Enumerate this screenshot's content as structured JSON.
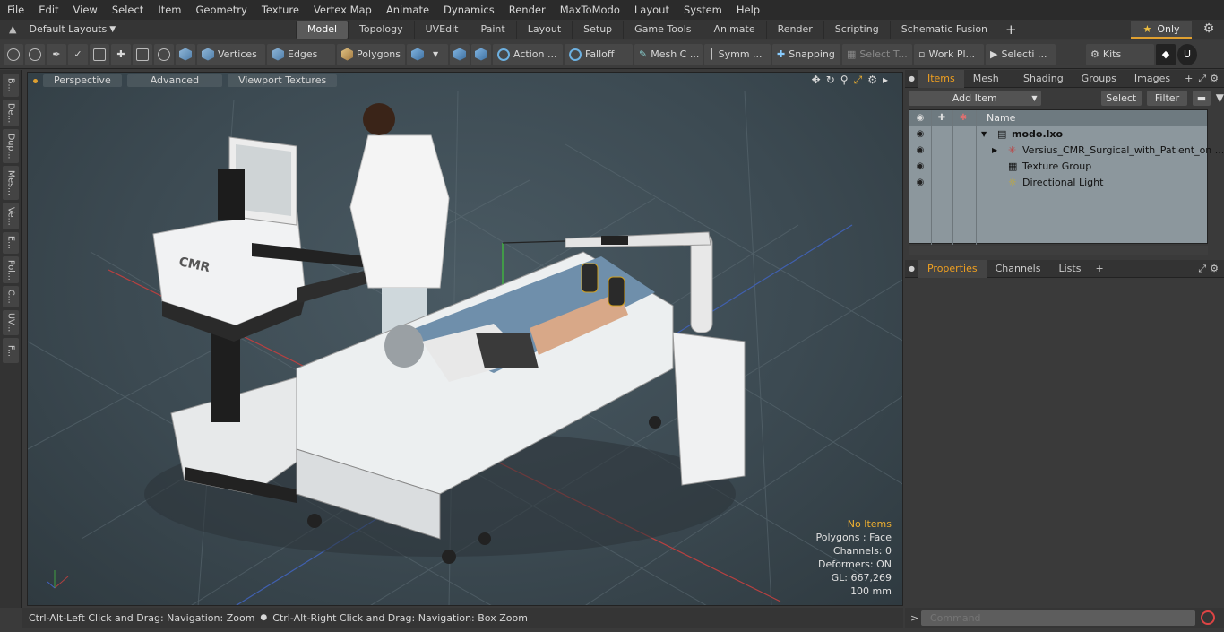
{
  "menu": [
    "File",
    "Edit",
    "View",
    "Select",
    "Item",
    "Geometry",
    "Texture",
    "Vertex Map",
    "Animate",
    "Dynamics",
    "Render",
    "MaxToModo",
    "Layout",
    "System",
    "Help"
  ],
  "layoutbar": {
    "default_layouts": "Default Layouts",
    "tabs": [
      "Model",
      "Topology",
      "UVEdit",
      "Paint",
      "Layout",
      "Setup",
      "Game Tools",
      "Animate",
      "Render",
      "Scripting",
      "Schematic Fusion"
    ],
    "active_tab": "Model",
    "only_label": "Only"
  },
  "toolbar": {
    "vertices": "Vertices",
    "edges": "Edges",
    "polygons": "Polygons",
    "action": "Action ...",
    "falloff": "Falloff",
    "mesh": "Mesh C ...",
    "symm": "Symm ...",
    "snapping": "Snapping",
    "select_t": "Select T...",
    "work_pl": "Work Pl...",
    "selecti": "Selecti ...",
    "kits": "Kits"
  },
  "left_tabs": [
    "B...",
    "De...",
    "Dup...",
    "Mes...",
    "Ve...",
    "E...",
    "Pol...",
    "C...",
    "UV...",
    "F..."
  ],
  "viewport": {
    "perspective": "Perspective",
    "advanced": "Advanced",
    "textures": "Viewport Textures",
    "info": {
      "no_items": "No Items",
      "polygons": "Polygons : Face",
      "channels": "Channels: 0",
      "deformers": "Deformers: ON",
      "gl": "GL: 667,269",
      "scale": "100 mm"
    }
  },
  "status": {
    "hint1": "Ctrl-Alt-Left Click and Drag: Navigation: Zoom",
    "hint2": "Ctrl-Alt-Right Click and Drag: Navigation: Box Zoom"
  },
  "items_panel": {
    "tabs": [
      "Items",
      "Mesh ...",
      "Shading",
      "Groups",
      "Images"
    ],
    "active": "Items",
    "add_item": "Add Item",
    "select": "Select",
    "filter": "Filter",
    "name_header": "Name",
    "tree": [
      {
        "label": "modo.lxo"
      },
      {
        "label": "Versius_CMR_Surgical_with_Patient_on ..."
      },
      {
        "label": "Texture Group"
      },
      {
        "label": "Directional Light"
      }
    ]
  },
  "props_panel": {
    "tabs": [
      "Properties",
      "Channels",
      "Lists"
    ],
    "active": "Properties"
  },
  "command": {
    "placeholder": "Command"
  }
}
